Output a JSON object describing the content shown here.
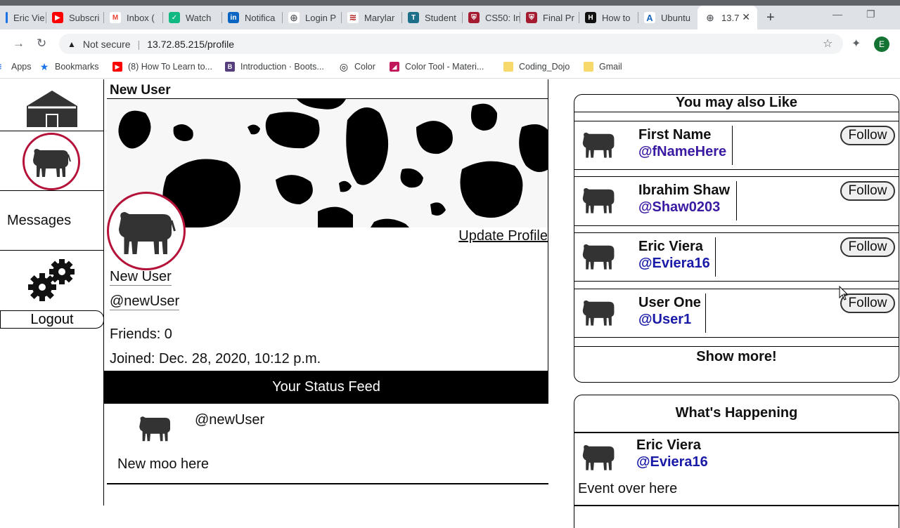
{
  "browser": {
    "tabs": [
      {
        "label": "Eric Vie",
        "color": "#1a73e8",
        "glyph": ""
      },
      {
        "label": "Subscri",
        "color": "#ff0000",
        "glyph": "▶"
      },
      {
        "label": "Inbox (",
        "color": "#ea4335",
        "glyph": "M"
      },
      {
        "label": "Watch",
        "color": "#10b981",
        "glyph": "✓"
      },
      {
        "label": "Notifica",
        "color": "#0a66c2",
        "glyph": "in"
      },
      {
        "label": "Login P",
        "color": "#5f6368",
        "glyph": "⊕"
      },
      {
        "label": "Marylar",
        "color": "#b31b1b",
        "glyph": "≋"
      },
      {
        "label": "Student",
        "color": "#1e6f8a",
        "glyph": "T"
      },
      {
        "label": "CS50: In",
        "color": "#a51c30",
        "glyph": "⛨"
      },
      {
        "label": "Final Pr",
        "color": "#a51c30",
        "glyph": "⛨"
      },
      {
        "label": "How to",
        "color": "#111111",
        "glyph": "H"
      },
      {
        "label": "Ubuntu",
        "color": "#1565c0",
        "glyph": "A"
      },
      {
        "label": "13.7",
        "color": "#5f6368",
        "glyph": "⊕"
      }
    ],
    "not_secure": "Not secure",
    "url": "13.72.85.215/profile",
    "profile_initial": "E",
    "bookmarks": [
      {
        "label": "Apps",
        "color": "#4285f4",
        "glyph": "⋮"
      },
      {
        "label": "Bookmarks",
        "color": "#1a73e8",
        "glyph": "★"
      },
      {
        "label": "(8) How To Learn to...",
        "color": "#ff0000",
        "glyph": "▶"
      },
      {
        "label": "Introduction · Boots...",
        "color": "#563d7c",
        "glyph": "B"
      },
      {
        "label": "Color",
        "color": "#222222",
        "glyph": "◎"
      },
      {
        "label": "Color Tool - Materi...",
        "color": "#c2185b",
        "glyph": "◢"
      },
      {
        "label": "Coding_Dojo",
        "color": "#f6d86b",
        "glyph": ""
      },
      {
        "label": "Gmail",
        "color": "#f6d86b",
        "glyph": ""
      }
    ]
  },
  "sidebar": {
    "messages_label": "Messages",
    "logout_label": "Logout"
  },
  "profile": {
    "header_title": "New User",
    "update_label": "Update Profile",
    "name": "New User",
    "handle": "@newUser",
    "friends": "Friends: 0",
    "joined": "Joined: Dec. 28, 2020, 10:12 p.m."
  },
  "feed": {
    "title": "Your Status Feed",
    "posts": [
      {
        "user": "@newUser",
        "text": "New moo here"
      }
    ]
  },
  "suggestions": {
    "title": "You may also Like",
    "follow_label": "Follow",
    "show_more": "Show more!",
    "items": [
      {
        "name": "First Name",
        "handle": "@fNameHere",
        "handle_color": "#3a1aa3"
      },
      {
        "name": "Ibrahim Shaw",
        "handle": "@Shaw0203",
        "handle_color": "#3a1aa3"
      },
      {
        "name": "Eric Viera",
        "handle": "@Eviera16",
        "handle_color": "#1a1aa8"
      },
      {
        "name": "User One",
        "handle": "@User1",
        "handle_color": "#1a1aa8"
      }
    ]
  },
  "happening": {
    "title": "What's Happening",
    "name": "Eric Viera",
    "handle": "@Eviera16",
    "text": "Event over here"
  },
  "colors": {
    "accent_ring": "#b5123a",
    "feed_header_bg": "#000000"
  }
}
